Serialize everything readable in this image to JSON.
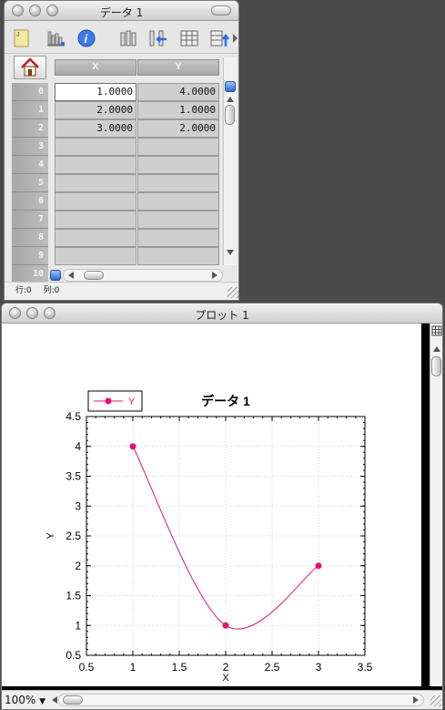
{
  "data_window": {
    "title": "データ 1",
    "columns": [
      "X",
      "Y"
    ],
    "row_numbers": [
      "0",
      "1",
      "2",
      "3",
      "4",
      "5",
      "6",
      "7",
      "8",
      "9",
      "10"
    ],
    "rows": [
      [
        "1.0000",
        "4.0000"
      ],
      [
        "2.0000",
        "1.0000"
      ],
      [
        "3.0000",
        "2.0000"
      ],
      [
        "",
        ""
      ],
      [
        "",
        ""
      ],
      [
        "",
        ""
      ],
      [
        "",
        ""
      ],
      [
        "",
        ""
      ],
      [
        "",
        ""
      ],
      [
        "",
        ""
      ]
    ],
    "status_row": "行:0",
    "status_col": "列:0",
    "toolbar_icons": [
      "note-icon",
      "bar-chart-icon",
      "info-icon",
      "column-icon",
      "insert-column-icon",
      "table-icon",
      "sort-up-icon"
    ]
  },
  "plot_window": {
    "title": "プロット 1",
    "zoom": "100%"
  },
  "chart_data": {
    "type": "line",
    "title": "データ 1",
    "xlabel": "X",
    "ylabel": "Y",
    "xlim": [
      0.5,
      3.5
    ],
    "ylim": [
      0.5,
      4.5
    ],
    "x_ticks": [
      "0.5",
      "1",
      "1.5",
      "2",
      "2.5",
      "3",
      "3.5"
    ],
    "y_ticks": [
      "0.5",
      "1",
      "1.5",
      "2",
      "2.5",
      "3",
      "3.5",
      "4",
      "4.5"
    ],
    "grid": true,
    "legend_placement": "top-left",
    "series": [
      {
        "name": "Y",
        "color": "#e0137a",
        "x": [
          1,
          2,
          3
        ],
        "y": [
          4,
          1,
          2
        ],
        "smooth": true
      }
    ]
  }
}
